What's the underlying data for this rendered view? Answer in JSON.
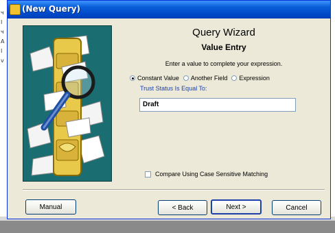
{
  "window": {
    "title": "(New Query)"
  },
  "wizard": {
    "title": "Query Wizard",
    "subtitle": "Value Entry",
    "instruction": "Enter a value to complete your expression."
  },
  "value_type": {
    "options": [
      "Constant Value",
      "Another Field",
      "Expression"
    ],
    "selected": "Constant Value"
  },
  "field": {
    "label": "Trust Status Is Equal To:",
    "value": "Draft"
  },
  "case_sensitive": {
    "label": "Compare Using Case Sensitive Matching",
    "checked": false
  },
  "buttons": {
    "manual": "Manual",
    "back": "< Back",
    "next": "Next >",
    "cancel": "Cancel"
  },
  "colors": {
    "titlebar": "#0a5fd8",
    "dialog_bg": "#ece9d8",
    "art_bg": "#1a6e72",
    "field_label": "#1c3fa8"
  }
}
